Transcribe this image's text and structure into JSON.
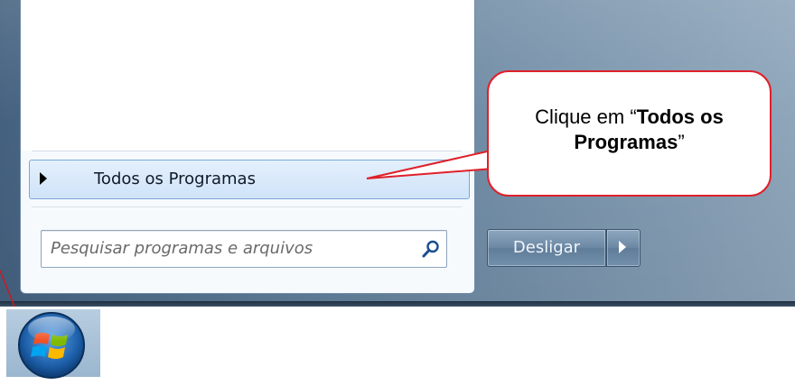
{
  "start_menu": {
    "all_programs_label": "Todos os Programas",
    "search": {
      "placeholder": "Pesquisar programas e arquivos",
      "value": ""
    },
    "shutdown_label": "Desligar"
  },
  "callout": {
    "prefix": "Clique em “",
    "bold": "Todos os Programas",
    "suffix": "”"
  },
  "colors": {
    "callout_border": "#e0202a",
    "highlight_border": "#7aa7d8",
    "menu_right_pane": "#5a7894"
  },
  "icons": {
    "all_programs": "triangle-right-icon",
    "search": "magnifier-icon",
    "shutdown_options": "triangle-right-icon",
    "start": "windows-logo-icon"
  }
}
